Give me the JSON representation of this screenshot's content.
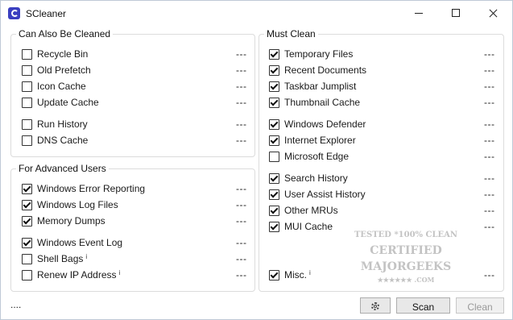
{
  "window": {
    "title": "SCleaner"
  },
  "groups": {
    "also": {
      "title": "Can Also Be Cleaned",
      "items": [
        {
          "label": "Recycle Bin",
          "checked": false,
          "value": "---"
        },
        {
          "label": "Old Prefetch",
          "checked": false,
          "value": "---"
        },
        {
          "label": "Icon Cache",
          "checked": false,
          "value": "---"
        },
        {
          "label": "Update Cache",
          "checked": false,
          "value": "---"
        },
        {
          "label": "Run History",
          "checked": false,
          "value": "---"
        },
        {
          "label": "DNS Cache",
          "checked": false,
          "value": "---"
        }
      ]
    },
    "advanced": {
      "title": "For Advanced Users",
      "items": [
        {
          "label": "Windows Error Reporting",
          "checked": true,
          "value": "---"
        },
        {
          "label": "Windows Log Files",
          "checked": true,
          "value": "---"
        },
        {
          "label": "Memory Dumps",
          "checked": true,
          "value": "---"
        },
        {
          "label": "Windows Event Log",
          "checked": true,
          "value": "---"
        },
        {
          "label": "Shell Bags",
          "checked": false,
          "value": "---",
          "info": "i"
        },
        {
          "label": "Renew IP Address",
          "checked": false,
          "value": "---",
          "info": "i"
        }
      ]
    },
    "must": {
      "title": "Must Clean",
      "items": [
        {
          "label": "Temporary Files",
          "checked": true,
          "value": "---"
        },
        {
          "label": "Recent Documents",
          "checked": true,
          "value": "---"
        },
        {
          "label": "Taskbar Jumplist",
          "checked": true,
          "value": "---"
        },
        {
          "label": "Thumbnail Cache",
          "checked": true,
          "value": "---"
        },
        {
          "label": "Windows Defender",
          "checked": true,
          "value": "---"
        },
        {
          "label": "Internet Explorer",
          "checked": true,
          "value": "---"
        },
        {
          "label": "Microsoft Edge",
          "checked": false,
          "value": "---"
        },
        {
          "label": "Search History",
          "checked": true,
          "value": "---"
        },
        {
          "label": "User Assist History",
          "checked": true,
          "value": "---"
        },
        {
          "label": "Other MRUs",
          "checked": true,
          "value": "---"
        },
        {
          "label": "MUI Cache",
          "checked": true,
          "value": "---"
        },
        {
          "label": "Misc.",
          "checked": true,
          "value": "---",
          "info": "i"
        }
      ]
    }
  },
  "status": {
    "text": "...."
  },
  "buttons": {
    "settings_icon": "gear-icon",
    "scan": "Scan",
    "clean": "Clean"
  },
  "watermark": {
    "line1": "TESTED *100% CLEAN",
    "line2": "CERTIFIED",
    "line3": "MAJORGEEKS",
    "line4": "★★★★★★ .COM"
  }
}
